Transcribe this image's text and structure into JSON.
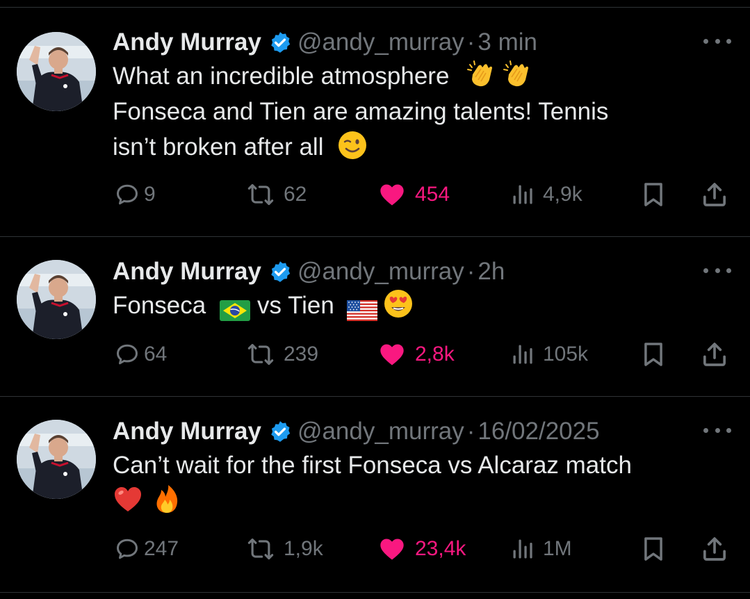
{
  "tweets": [
    {
      "name": "Andy Murray",
      "handle": "@andy_murray",
      "separator": "·",
      "time": "3 min",
      "text_lines": [
        "What an incredible atmosphere",
        "Fonseca and Tien are amazing talents! Tennis",
        "isn’t broken after all"
      ],
      "emojis": [
        "clapping-hands",
        "clapping-hands",
        "winking-face"
      ],
      "stats": {
        "replies": "9",
        "reposts": "62",
        "likes": "454",
        "views": "4,9k"
      }
    },
    {
      "name": "Andy Murray",
      "handle": "@andy_murray",
      "separator": "·",
      "time": "2h",
      "text_parts": [
        "Fonseca",
        "vs Tien"
      ],
      "emojis": [
        "flag-brazil",
        "flag-usa",
        "heart-eyes-face"
      ],
      "stats": {
        "replies": "64",
        "reposts": "239",
        "likes": "2,8k",
        "views": "105k"
      }
    },
    {
      "name": "Andy Murray",
      "handle": "@andy_murray",
      "separator": "·",
      "time": "16/02/2025",
      "text_lines": [
        "Can’t wait for the first Fonseca vs Alcaraz match"
      ],
      "emojis": [
        "red-heart",
        "fire"
      ],
      "stats": {
        "replies": "247",
        "reposts": "1,9k",
        "likes": "23,4k",
        "views": "1M"
      }
    }
  ],
  "colors": {
    "background": "#000000",
    "text": "#e7e9ea",
    "secondary": "#71767b",
    "like": "#f91880",
    "verified": "#1d9bf0",
    "divider": "#2f3336"
  },
  "icons": [
    "reply-icon",
    "repost-icon",
    "like-icon",
    "views-icon",
    "bookmark-icon",
    "share-icon",
    "more-icon",
    "verified-badge-icon"
  ]
}
